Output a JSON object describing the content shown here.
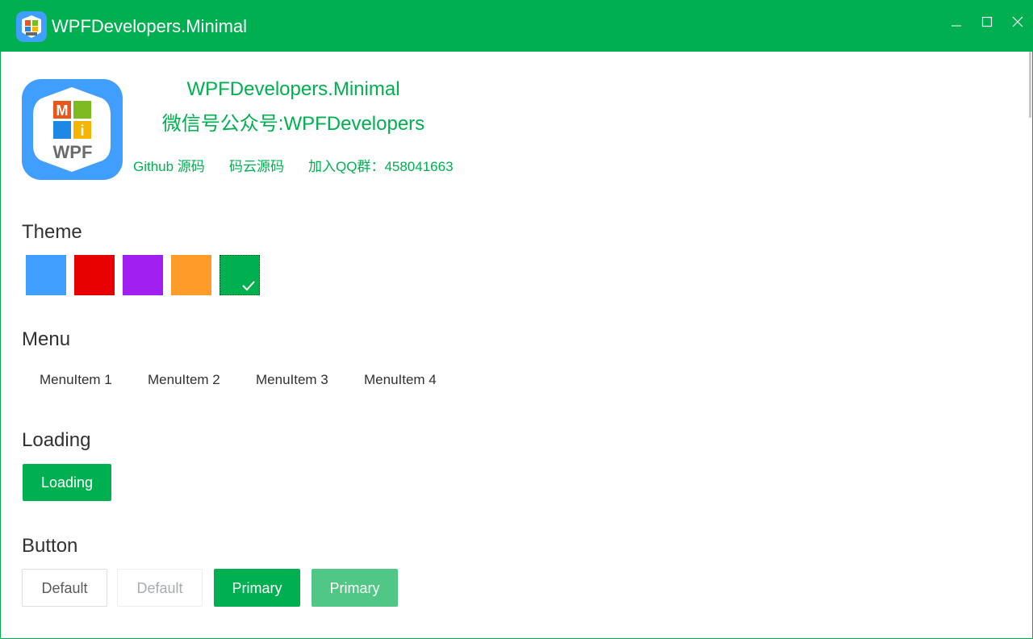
{
  "window": {
    "title": "WPFDevelopers.Minimal",
    "accent_color": "#00b050"
  },
  "header": {
    "app_name": "WPFDevelopers.Minimal",
    "wechat": "微信号公众号:WPFDevelopers",
    "links": {
      "github": "Github 源码",
      "gitee": "码云源码",
      "qq_group": "加入QQ群：458041663"
    },
    "logo_text": {
      "m": "M",
      "i": "i",
      "wpf": "WPF"
    }
  },
  "theme": {
    "title": "Theme",
    "swatches": [
      {
        "color": "#409eff",
        "selected": false
      },
      {
        "color": "#e60000",
        "selected": false
      },
      {
        "color": "#a020f0",
        "selected": false
      },
      {
        "color": "#ff9b28",
        "selected": false
      },
      {
        "color": "#00b050",
        "selected": true
      }
    ]
  },
  "menu": {
    "title": "Menu",
    "items": [
      "MenuItem 1",
      "MenuItem 2",
      "MenuItem 3",
      "MenuItem 4"
    ]
  },
  "loading": {
    "title": "Loading",
    "button_label": "Loading"
  },
  "button": {
    "title": "Button",
    "default_label": "Default",
    "default_disabled_label": "Default",
    "primary_label": "Primary",
    "primary_disabled_label": "Primary"
  }
}
